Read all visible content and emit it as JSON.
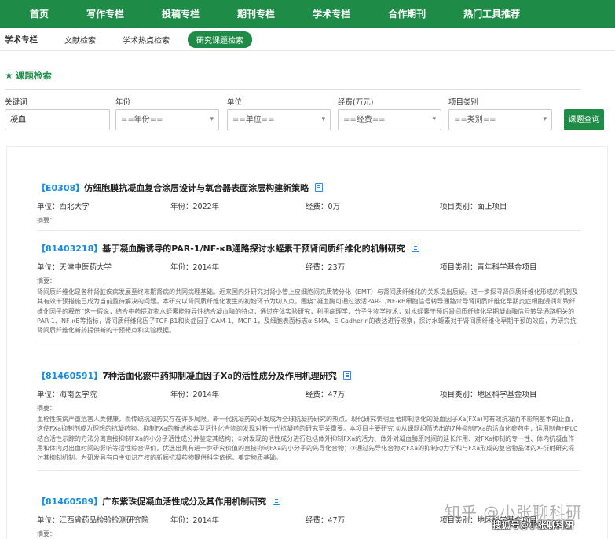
{
  "topnav": [
    "首页",
    "写作专栏",
    "投稿专栏",
    "期刊专栏",
    "学术专栏",
    "合作期刊",
    "热门工具推荐"
  ],
  "subnav": [
    "学术专栏",
    "文献检索",
    "学术热点检索",
    "研究课题检索"
  ],
  "section": {
    "star": "★",
    "title": "课题检索"
  },
  "filters": {
    "keyword": {
      "label": "关键词",
      "value": "凝血"
    },
    "year": {
      "label": "年份",
      "value": "==年份=="
    },
    "unit": {
      "label": "单位",
      "value": "==单位=="
    },
    "funding": {
      "label": "经费(万元)",
      "value": "==经费=="
    },
    "category": {
      "label": "项目类别",
      "value": "==类别=="
    },
    "search_label": "课题查询",
    "caret": "▾"
  },
  "results": [
    {
      "code": "【E0308】",
      "title": "仿细胞膜抗凝血复合涂层设计与氧合器表面涂层构建新策略",
      "unit": "单位：西北大学",
      "year": "年份：2022年",
      "fund": "经费：0万",
      "category": "项目类别：面上项目",
      "abstract_label": "摘要：",
      "abstract": ""
    },
    {
      "code": "【81403218】",
      "title": "基于凝血酶诱导的PAR-1/NF-κB通路探讨水蛭素干预肾间质纤维化的机制研究",
      "unit": "单位：天津中医药大学",
      "year": "年份：2014年",
      "fund": "经费：23万",
      "category": "项目类别：青年科学基金项目",
      "abstract_label": "摘要：",
      "abstract": "肾间质纤维化是各种肾脏疾病发展至终末期肾病的共同病理基础。近来国内外研究对肾小管上皮细胞间充质转分化（EMT）与肾间质纤维化的关系提出质疑。进一步探寻肾间质纤维化形成的机制及其有效干预措施已成为当前亟待解决的问题。本研究以肾间质纤维化发生的初始环节为切入点，围绕“凝血酶可通过激活PAR-1/NF-κB细胞信号转导通路介导肾间质纤维化早期炎症细胞浸润和致纤维化因子的释放”这一假说，结合中药提取物水蛭素能特异性结合凝血酶的特点，通过在体实验研究，利用病理学、分子生物学技术，对水蛭素干预后肾间质纤维化早期凝血酶信号转导通路相关的PAR-1、NF-κB等指标，肾间质纤维化因子TGF-β1和炎症因子ICAM-1、MCP-1，及细胞表面标志α-SMA、E-Cadherin的表达进行观察，探讨水蛭素对于肾间质纤维化早期干预的效应，为研究抗肾间质纤维化新药提供新的干预靶点和实验根据。"
    },
    {
      "code": "【81460591】",
      "title": "7种活血化瘀中药抑制凝血因子Xa的活性成分及作用机理研究",
      "unit": "单位：海南医学院",
      "year": "年份：2014年",
      "fund": "经费：47万",
      "category": "项目类别：地区科学基金项目",
      "abstract_label": "摘要：",
      "abstract": "血栓性疾病严重危害人类健康，而传统抗凝药又存在许多局限。新一代抗凝药的研发成为全球抗凝药研究的热点。现代研究表明显著抑制活化的凝血因子Xa(FXa)可有效抗凝而不影响基本的止血，这使FXa抑制剂成为理想的抗凝药物。抑制FXa的新结构类型活性化合物的发现对新一代抗凝药的研究至关重要。本项目主要研究 ①从课题组筛选出的7种抑制FXa的活血化瘀药中，运用制备HPLC结合活性示踪的方法分离直接抑制FXa的小分子活性成分并鉴定其结构；②对发现的活性成分进行包括体外抑制FXa的活力、体外对凝血酶原时间的延长作用、对FXa抑制的专一性、体内抗凝血作用和体内对出血时间的影响等活性综合评价，优选出具有进一步研究价值的直接抑制FXa的小分子的先导化合物；③通过先导化合物对FXa的抑制动力学和与FXa形成的复合物晶体的X-衍射研究探讨其抑制机制。为研发具有自主知识产权的新颖抗凝药物提供科学依据，奠定物质基础。"
    },
    {
      "code": "【81460589】",
      "title": "广东紫珠促凝血活性成分及其作用机制研究",
      "unit": "单位：江西省药品检验检测研究院",
      "year": "年份：2014年",
      "fund": "经费：47万",
      "category": "项目类别：地区科学基金项目",
      "abstract_label": "摘要：",
      "abstract": ""
    }
  ],
  "watermark": {
    "line1": "知乎 @小张聊科研",
    "line2": "搜狐号@小张聊科研"
  }
}
